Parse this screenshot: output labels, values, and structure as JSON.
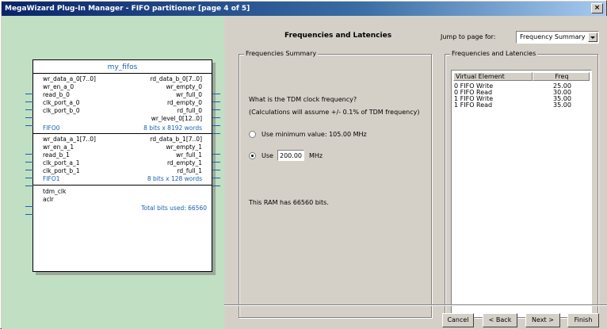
{
  "window": {
    "title": "MegaWizard Plug-In Manager - FIFO partitioner [page 4 of 5]",
    "close": "×"
  },
  "symbol": {
    "name": "my_fifos",
    "fifo0": {
      "inputs": [
        "wr_data_a_0[7..0]",
        "wr_en_a_0",
        "read_b_0",
        "clk_port_a_0",
        "clk_port_b_0"
      ],
      "outputs": [
        "rd_data_b_0[7..0]",
        "wr_empty_0",
        "wr_full_0",
        "rd_empty_0",
        "rd_full_0",
        "wr_level_0[12..0]"
      ],
      "label": "FIFO0",
      "size": "8 bits x 8192 words"
    },
    "fifo1": {
      "inputs": [
        "wr_data_a_1[7..0]",
        "wr_en_a_1",
        "read_b_1",
        "clk_port_a_1",
        "clk_port_b_1"
      ],
      "outputs": [
        "rd_data_b_1[7..0]",
        "wr_empty_1",
        "wr_full_1",
        "rd_empty_1",
        "rd_full_1"
      ],
      "label": "FIFO1",
      "size": "8 bits x 128 words"
    },
    "common_inputs": [
      "tdm_clk",
      "aclr"
    ],
    "total_bits": "Total bits used: 66560"
  },
  "main": {
    "heading": "Frequencies and Latencies",
    "jump_label": "Jump to page for:",
    "jump_value": "Frequency Summary"
  },
  "summary": {
    "title": "Frequencies Summary",
    "question": "What is the TDM clock frequency?",
    "note": "(Calculations will assume +/- 0.1% of TDM frequency)",
    "option_min": "Use minimum value:  105.00 MHz",
    "option_use": "Use",
    "use_value": "200.00",
    "use_unit": "MHz",
    "ram_bits": "This RAM has 66560 bits."
  },
  "latencies": {
    "title": "Frequencies and Latencies",
    "headers": [
      "Virtual Element",
      "Freq"
    ],
    "rows": [
      {
        "element": "0 FIFO Write",
        "freq": "25.00"
      },
      {
        "element": "0 FIFO Read",
        "freq": "30.00"
      },
      {
        "element": "1 FIFO Write",
        "freq": "35.00"
      },
      {
        "element": "1 FIFO Read",
        "freq": "35.00"
      }
    ]
  },
  "buttons": {
    "cancel": "Cancel",
    "back": "< Back",
    "next": "Next >",
    "finish": "Finish"
  }
}
